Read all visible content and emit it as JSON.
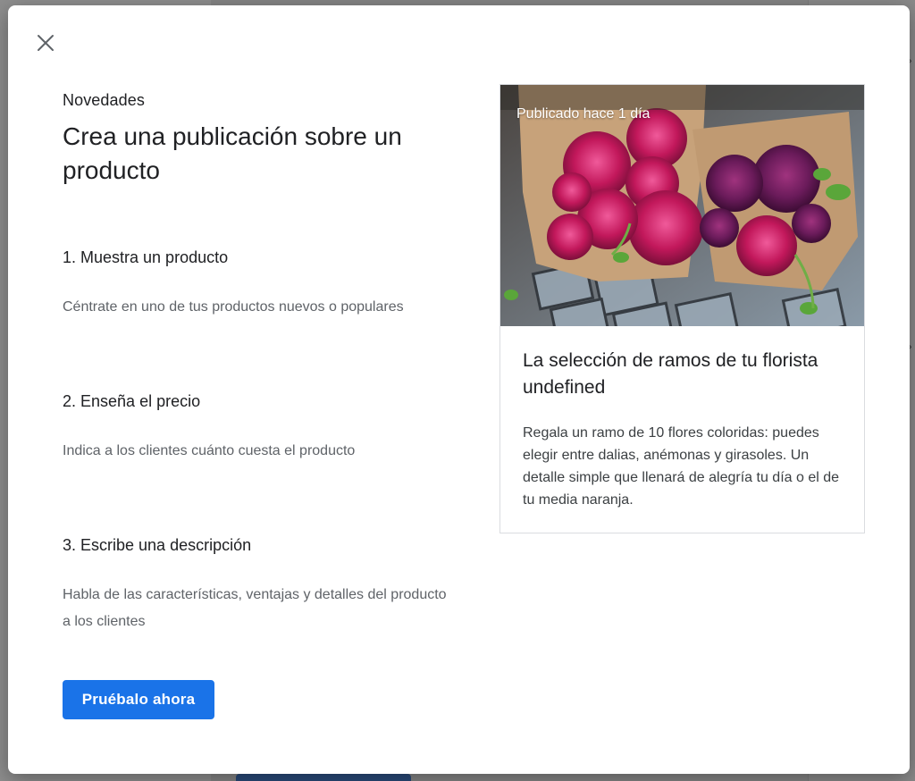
{
  "dialog": {
    "eyebrow": "Novedades",
    "title": "Crea una publicación sobre un producto",
    "steps": [
      {
        "title": "1. Muestra un producto",
        "description": "Céntrate en uno de tus productos nuevos o populares"
      },
      {
        "title": "2. Enseña el precio",
        "description": "Indica a los clientes cuánto cuesta el producto"
      },
      {
        "title": "3. Escribe una descripción",
        "description": "Habla de las características, ventajas y detalles del producto a los clientes"
      }
    ],
    "cta_label": "Pruébalo ahora",
    "close_icon": "close-icon"
  },
  "preview": {
    "timestamp": "Publicado hace 1 día",
    "title": "La selección de ramos de tu florista undefined",
    "description": "Regala un ramo de 10 flores coloridas: puedes elegir entre dalias, anémonas y girasoles. Un detalle simple que llenará de alegría tu día o el de tu media naranja."
  },
  "colors": {
    "primary": "#1a73e8",
    "text_primary": "#202124",
    "text_secondary": "#5f6368",
    "overlay": "#858585"
  }
}
